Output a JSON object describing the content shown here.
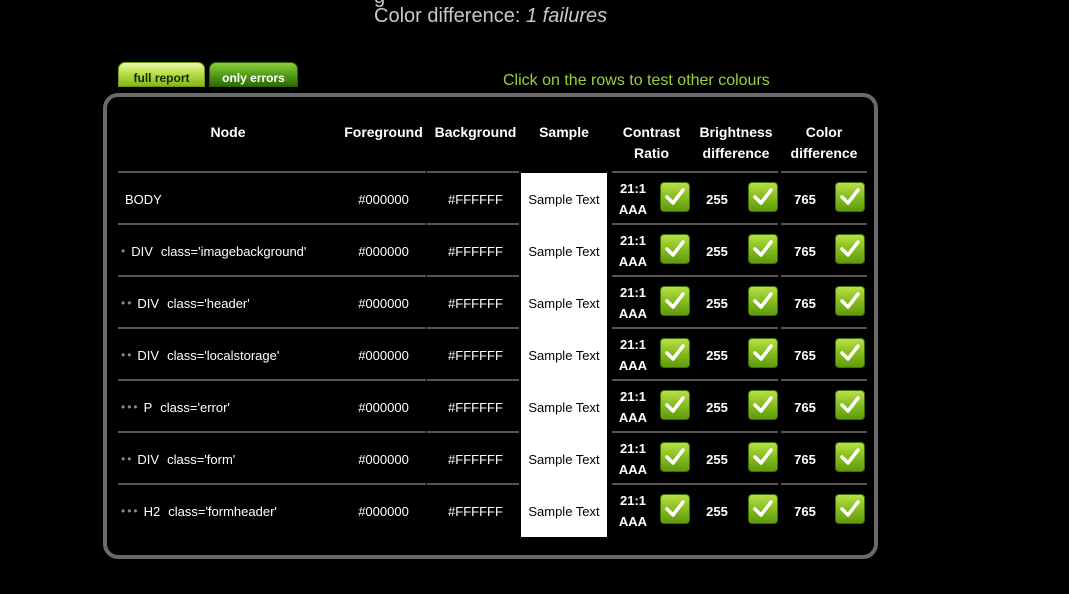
{
  "summary": {
    "prev_line_fragment": "g",
    "color_difference_label": "Color difference:",
    "color_difference_value": "1 failures"
  },
  "tabs": [
    {
      "label": "full report",
      "active": true
    },
    {
      "label": "only errors",
      "active": false
    }
  ],
  "hint": "Click on the rows to test other colours",
  "columns": {
    "node": "Node",
    "foreground": "Foreground",
    "background": "Background",
    "sample": "Sample",
    "contrast_line1": "Contrast",
    "contrast_line2": "Ratio",
    "brightness_line1": "Brightness",
    "brightness_line2": "difference",
    "color_line1": "Color",
    "color_line2": "difference"
  },
  "rows": [
    {
      "dots": "",
      "tag": "BODY",
      "attr": "",
      "foreground": "#000000",
      "background": "#FFFFFF",
      "sample": "Sample Text",
      "ratio": "21:1",
      "level": "AAA",
      "brightness": "255",
      "color_diff": "765"
    },
    {
      "dots": "•",
      "tag": "DIV",
      "attr": "class='imagebackground'",
      "foreground": "#000000",
      "background": "#FFFFFF",
      "sample": "Sample Text",
      "ratio": "21:1",
      "level": "AAA",
      "brightness": "255",
      "color_diff": "765"
    },
    {
      "dots": "••",
      "tag": "DIV",
      "attr": "class='header'",
      "foreground": "#000000",
      "background": "#FFFFFF",
      "sample": "Sample Text",
      "ratio": "21:1",
      "level": "AAA",
      "brightness": "255",
      "color_diff": "765"
    },
    {
      "dots": "••",
      "tag": "DIV",
      "attr": "class='localstorage'",
      "foreground": "#000000",
      "background": "#FFFFFF",
      "sample": "Sample Text",
      "ratio": "21:1",
      "level": "AAA",
      "brightness": "255",
      "color_diff": "765"
    },
    {
      "dots": "•••",
      "tag": "P",
      "attr": "class='error'",
      "foreground": "#000000",
      "background": "#FFFFFF",
      "sample": "Sample Text",
      "ratio": "21:1",
      "level": "AAA",
      "brightness": "255",
      "color_diff": "765"
    },
    {
      "dots": "••",
      "tag": "DIV",
      "attr": "class='form'",
      "foreground": "#000000",
      "background": "#FFFFFF",
      "sample": "Sample Text",
      "ratio": "21:1",
      "level": "AAA",
      "brightness": "255",
      "color_diff": "765"
    },
    {
      "dots": "•••",
      "tag": "H2",
      "attr": "class='formheader'",
      "foreground": "#000000",
      "background": "#FFFFFF",
      "sample": "Sample Text",
      "ratio": "21:1",
      "level": "AAA",
      "brightness": "255",
      "color_diff": "765"
    }
  ],
  "colors": {
    "accent_green": "#9ad23a",
    "panel_border": "#6a6a6a",
    "page_background": "#000000"
  },
  "icons": {
    "pass": "checkmark-icon"
  }
}
